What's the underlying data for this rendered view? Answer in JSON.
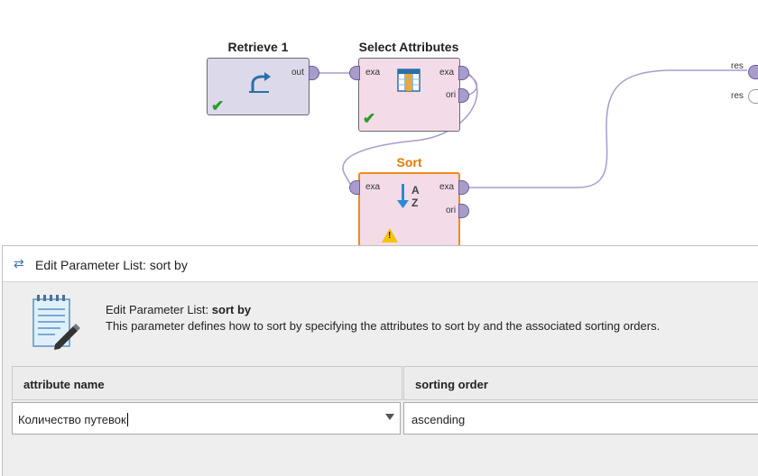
{
  "process": {
    "operators": [
      {
        "title": "Retrieve 1",
        "ports_out": [
          "out"
        ],
        "status": "ok"
      },
      {
        "title": "Select Attributes",
        "ports_in": [
          "exa"
        ],
        "ports_out": [
          "exa",
          "ori"
        ],
        "status": "ok"
      },
      {
        "title": "Sort",
        "ports_in": [
          "exa"
        ],
        "ports_out": [
          "exa",
          "ori"
        ],
        "status": "warning",
        "selected": true
      }
    ],
    "result_ports": [
      "res",
      "res"
    ],
    "icons": {
      "retrieve": "retrieve-arrow-icon",
      "select": "table-columns-icon",
      "sort": "sort-az-icon",
      "ok": "checkmark-icon",
      "warning": "warning-icon"
    },
    "colors": {
      "selected_border": "#f08c1e",
      "sort_title": "#e07b00",
      "wire": "#a89ccb",
      "check": "#2e9a2e",
      "warning": "#f4c400"
    }
  },
  "dialog": {
    "title": "Edit Parameter List: sort by",
    "header_prefix": "Edit Parameter List: ",
    "header_param": "sort by",
    "description": "This parameter defines how to sort by specifying the attributes to sort by and the associated sorting orders.",
    "icon": "notepad-pencil-icon",
    "table": {
      "columns": [
        "attribute name",
        "sorting order"
      ],
      "rows": [
        {
          "attribute": "Количество путевок",
          "order": "ascending"
        }
      ]
    }
  }
}
